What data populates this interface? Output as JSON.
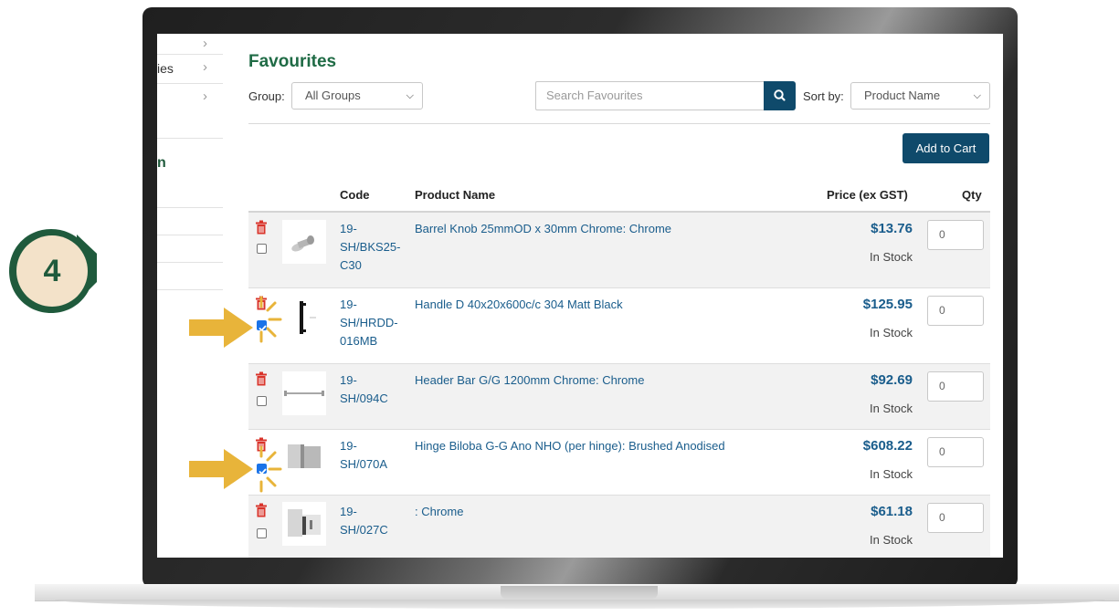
{
  "step_marker": {
    "number": "4"
  },
  "sidebar": {
    "items": [
      {
        "label": ""
      },
      {
        "label": "ies"
      },
      {
        "label": ""
      }
    ],
    "heading_fragment": "n"
  },
  "page": {
    "title": "Favourites"
  },
  "filters": {
    "group_label": "Group:",
    "group_value": "All Groups",
    "search_placeholder": "Search Favourites",
    "sort_label": "Sort by:",
    "sort_value": "Product Name"
  },
  "actions": {
    "add_to_cart": "Add to Cart"
  },
  "table": {
    "headers": {
      "code": "Code",
      "name": "Product Name",
      "price": "Price (ex GST)",
      "qty": "Qty"
    },
    "rows": [
      {
        "code_lines": [
          "19-",
          "SH/BKS25-",
          "C30"
        ],
        "name": "Barrel Knob 25mmOD x 30mm Chrome: Chrome",
        "price": "$13.76",
        "stock": "In Stock",
        "qty": "0",
        "checked": false,
        "thumb": "barrel-knob"
      },
      {
        "code_lines": [
          "19-",
          "SH/HRDD-",
          "016MB"
        ],
        "name": "Handle D 40x20x600c/c 304 Matt Black",
        "price": "$125.95",
        "stock": "In Stock",
        "qty": "0",
        "checked": true,
        "thumb": "d-handle"
      },
      {
        "code_lines": [
          "19-",
          "SH/094C"
        ],
        "name": "Header Bar G/G 1200mm Chrome: Chrome",
        "price": "$92.69",
        "stock": "In Stock",
        "qty": "0",
        "checked": false,
        "thumb": "header-bar"
      },
      {
        "code_lines": [
          "19-",
          "SH/070A"
        ],
        "name": "Hinge Biloba G-G Ano NHO (per hinge): Brushed Anodised",
        "price": "$608.22",
        "stock": "In Stock",
        "qty": "0",
        "checked": true,
        "thumb": "hinge"
      },
      {
        "code_lines": [
          "19-",
          "SH/027C"
        ],
        "name": ": Chrome",
        "price": "$61.18",
        "stock": "In Stock",
        "qty": "0",
        "checked": false,
        "thumb": "glass-clamp"
      }
    ]
  },
  "colors": {
    "brand_green": "#1f5a3c",
    "primary_blue": "#0f4a6b",
    "link_blue": "#1a5d8c",
    "delete_red": "#d9342b",
    "highlight_gold": "#e8b43a"
  }
}
